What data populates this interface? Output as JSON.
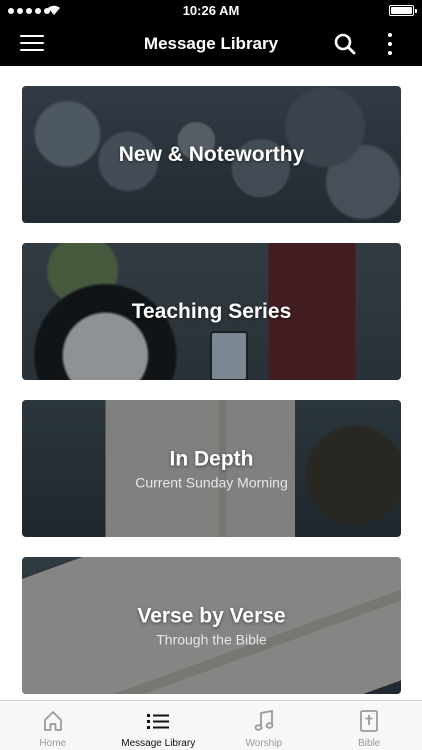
{
  "status_bar": {
    "time": "10:26 AM"
  },
  "nav": {
    "title": "Message Library",
    "menu_icon": "hamburger-menu-icon",
    "search_icon": "search-icon",
    "more_icon": "more-vertical-icon"
  },
  "cards": [
    {
      "title": "New & Noteworthy",
      "subtitle": ""
    },
    {
      "title": "Teaching Series",
      "subtitle": ""
    },
    {
      "title": "In Depth",
      "subtitle": "Current Sunday Morning"
    },
    {
      "title": "Verse by Verse",
      "subtitle": "Through the Bible"
    }
  ],
  "tabs": [
    {
      "label": "Home",
      "icon": "home-icon",
      "active": false
    },
    {
      "label": "Message Library",
      "icon": "list-icon",
      "active": true
    },
    {
      "label": "Worship",
      "icon": "music-note-icon",
      "active": false
    },
    {
      "label": "Bible",
      "icon": "bible-icon",
      "active": false
    }
  ],
  "colors": {
    "nav_background": "#000000",
    "tab_active": "#111111",
    "tab_inactive": "#9a9a9a"
  }
}
